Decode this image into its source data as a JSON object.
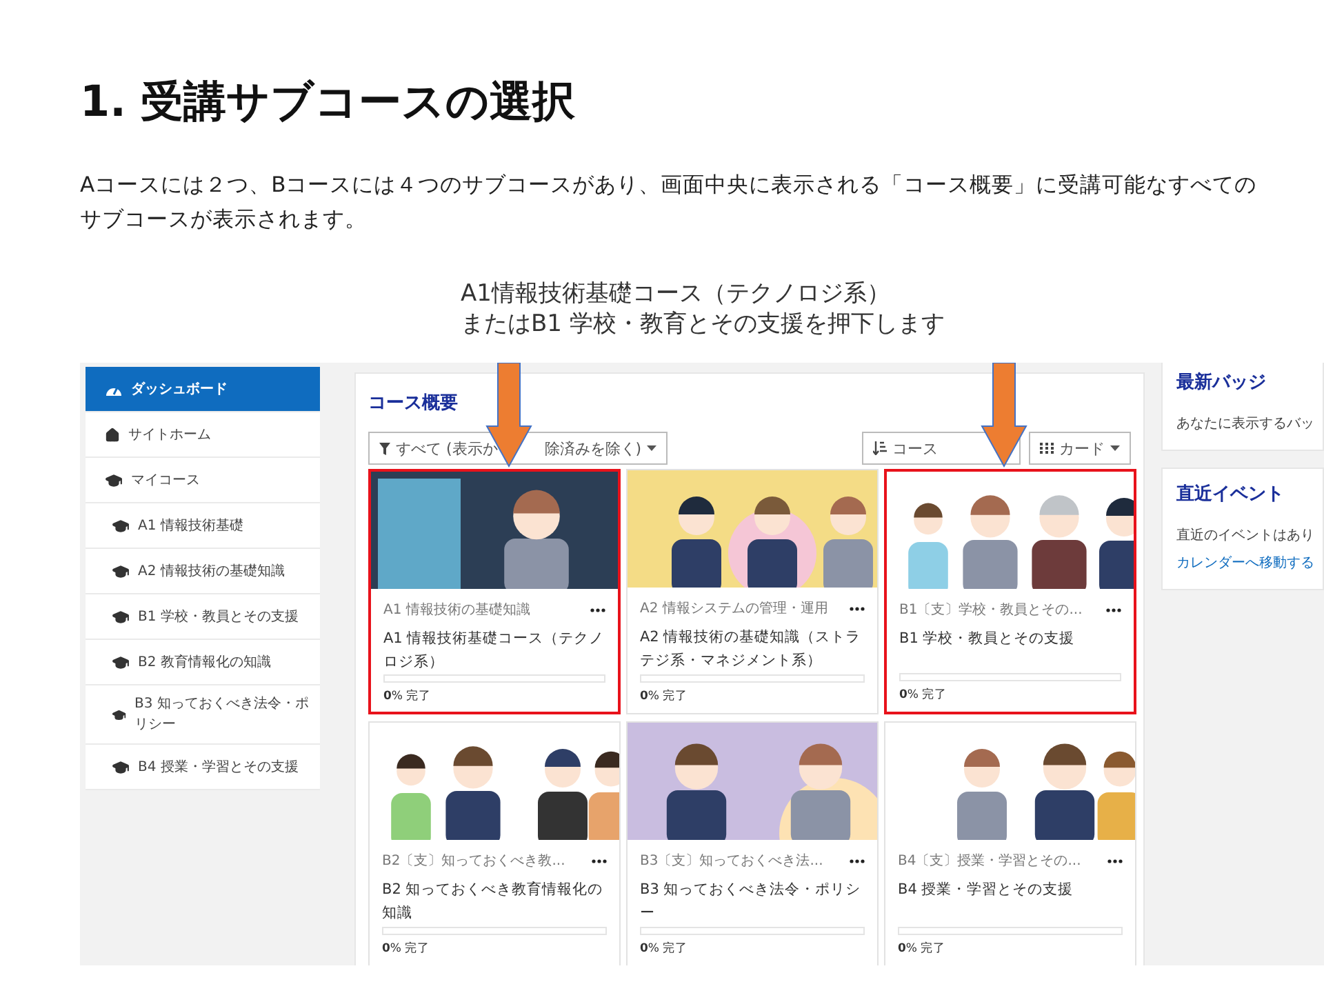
{
  "slide": {
    "title": "1. 受講サブコースの選択",
    "intro": "Aコースには２つ、Bコースには４つのサブコースがあり、画面中央に表示される「コース概要」に受講可能なすべてのサブコースが表示されます。",
    "callout": [
      "A1情報技術基礎コース（テクノロジ系）",
      "またはB1 学校・教育とその支援を押下します"
    ]
  },
  "sidebar": [
    {
      "kind": "dashboard",
      "label": "ダッシュボード",
      "selected": true
    },
    {
      "kind": "home",
      "label": "サイトホーム",
      "selected": false
    },
    {
      "kind": "mycourses",
      "label": "マイコース",
      "selected": false
    },
    {
      "kind": "course",
      "label": "A1 情報技術基礎",
      "selected": false
    },
    {
      "kind": "course",
      "label": "A2 情報技術の基礎知識",
      "selected": false
    },
    {
      "kind": "course",
      "label": "B1 学校・教員とその支援",
      "selected": false
    },
    {
      "kind": "course",
      "label": "B2 教育情報化の知識",
      "selected": false
    },
    {
      "kind": "course",
      "label": "B3 知っておくべき法令・ポリシー",
      "selected": false
    },
    {
      "kind": "course",
      "label": "B4 授業・学習とその支援",
      "selected": false
    }
  ],
  "overview": {
    "heading": "コース概要",
    "filter": [
      "すべて (表示か",
      "除済みを除く)"
    ],
    "sort": "コース",
    "view": "カード",
    "cards": [
      {
        "category": "A1 情報技術の基礎知識",
        "title": "A1 情報技術基礎コース（テクノロジ系）",
        "progress": "**0**% 完了",
        "level": 0,
        "highlighted": true
      },
      {
        "category": "A2 情報システムの管理・運用",
        "title": "A2 情報技術の基礎知識（ストラテジ系・マネジメント系）",
        "progress": "**0**% 完了",
        "level": 0,
        "highlighted": false
      },
      {
        "category": "B1〔支〕学校・教員とその...",
        "title": "B1 学校・教員とその支援",
        "progress": "**0**% 完了",
        "level": 0,
        "highlighted": true
      },
      {
        "category": "B2〔支〕知っておくべき教...",
        "title": "B2 知っておくべき教育情報化の知識",
        "progress": "**0**% 完了",
        "level": 0,
        "highlighted": false
      },
      {
        "category": "B3〔支〕知っておくべき法...",
        "title": "B3 知っておくべき法令・ポリシー",
        "progress": "**0**% 完了",
        "level": 0,
        "highlighted": false
      },
      {
        "category": "B4〔支〕授業・学習とその...",
        "title": "B4 授業・学習とその支援",
        "progress": "**0**% 完了",
        "level": 0,
        "highlighted": false
      }
    ]
  },
  "blocks": [
    {
      "heading": "最新バッジ",
      "text": "あなたに表示するバッ"
    },
    {
      "heading": "直近イベント",
      "text": "直近のイベントはあり",
      "link": "カレンダーへ移動する"
    }
  ]
}
